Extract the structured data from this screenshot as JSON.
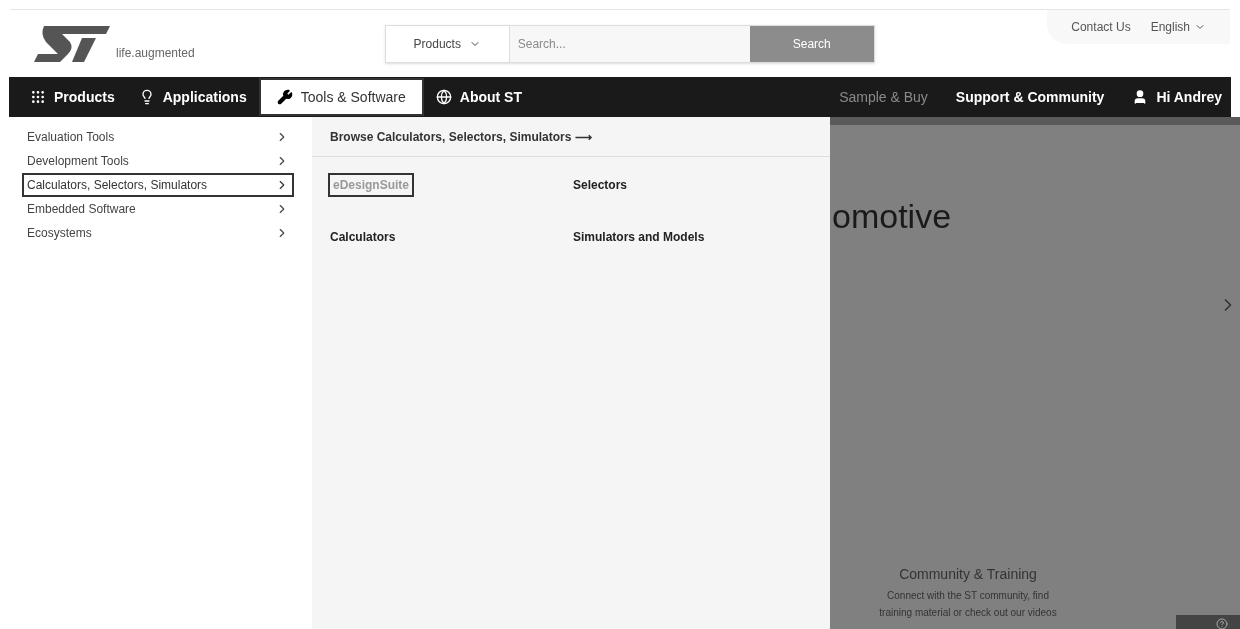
{
  "logo": {
    "tagline": "life.augmented"
  },
  "utility_links": [
    {
      "label": "Contact Us",
      "dropdown": false
    },
    {
      "label": "English",
      "dropdown": true
    }
  ],
  "search": {
    "scope": "Products",
    "placeholder": "Search...",
    "button": "Search"
  },
  "nav_left": [
    {
      "label": "Products",
      "selected": false
    },
    {
      "label": "Applications",
      "selected": false
    },
    {
      "label": "Tools & Software",
      "selected": true
    },
    {
      "label": "About ST",
      "selected": false
    }
  ],
  "nav_right": [
    {
      "label": "Sample & Buy",
      "dimmed": true
    },
    {
      "label": "Support & Community",
      "dimmed": false
    },
    {
      "label": "Hi Andrey",
      "dimmed": false
    }
  ],
  "submenu": [
    {
      "label": "Evaluation Tools",
      "selected": false
    },
    {
      "label": "Development Tools",
      "selected": false
    },
    {
      "label": "Calculators, Selectors, Simulators",
      "selected": true
    },
    {
      "label": "Embedded Software",
      "selected": false
    },
    {
      "label": "Ecosystems",
      "selected": false
    }
  ],
  "panel": {
    "browse_link": "Browse Calculators, Selectors, Simulators ⟶",
    "links": [
      {
        "label": "eDesignSuite",
        "selected": true
      },
      {
        "label": "Selectors",
        "selected": false
      },
      {
        "label": "Calculators",
        "selected": false
      },
      {
        "label": "Simulators and Models",
        "selected": false
      }
    ]
  },
  "hero": {
    "title": "omotive",
    "card_title": "Community & Training",
    "card_text": "Connect with the ST community, find training material or check out our videos"
  }
}
